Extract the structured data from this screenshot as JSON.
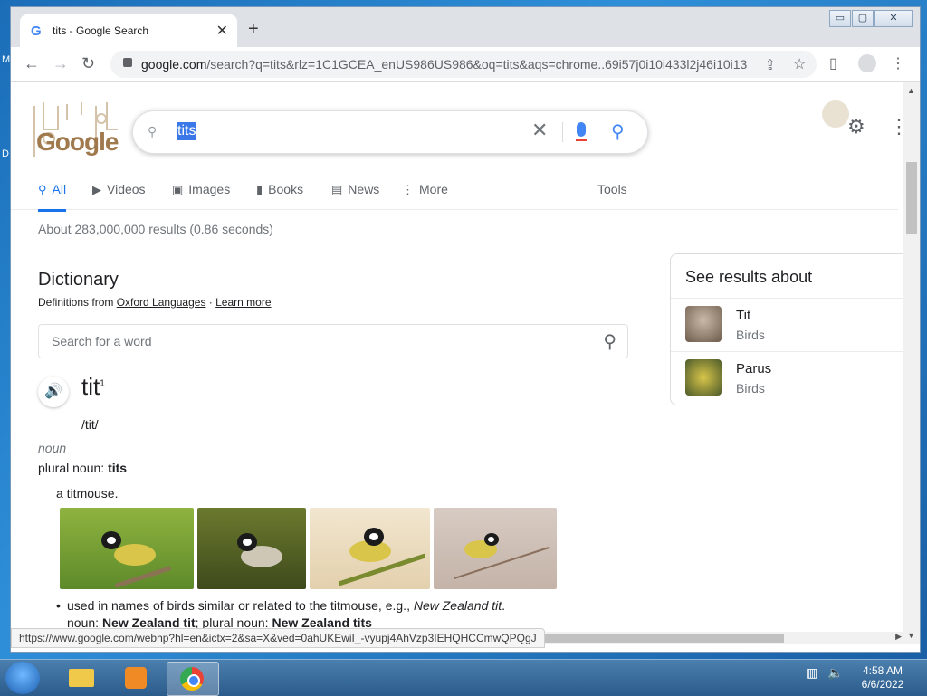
{
  "window": {
    "tab_title": "tits - Google Search",
    "tab_close": "✕",
    "new_tab": "+",
    "url_host": "google.com",
    "url_rest": "/search?q=tits&rlz=1C1GCEA_enUS986US986&oq=tits&aqs=chrome..69i57j0i10i433l2j46i10i13...",
    "controls": {
      "minimize": "▭",
      "maximize": "▢",
      "close": "✕"
    }
  },
  "search": {
    "logo": "Google",
    "query": "tits",
    "clear": "✕"
  },
  "tabs": [
    {
      "label": "All",
      "icon": "search-icon"
    },
    {
      "label": "Videos",
      "icon": "video-icon"
    },
    {
      "label": "Images",
      "icon": "image-icon"
    },
    {
      "label": "Books",
      "icon": "book-icon"
    },
    {
      "label": "News",
      "icon": "news-icon"
    },
    {
      "label": "More",
      "icon": "more-vert-icon"
    }
  ],
  "tools_label": "Tools",
  "result_stats": "About 283,000,000 results (0.86 seconds)",
  "dictionary": {
    "title": "Dictionary",
    "source_prefix": "Definitions from ",
    "source_link": "Oxford Languages",
    "source_sep": " · ",
    "learn_more": "Learn more",
    "search_placeholder": "Search for a word",
    "headword": "tit",
    "homograph": "1",
    "phonetic": "/tit/",
    "pos": "noun",
    "plural_label": "plural noun: ",
    "plural_value": "tits",
    "sense1": "a titmouse.",
    "sense2_text": "used in names of birds similar or related to the titmouse, e.g., ",
    "sense2_example": "New Zealand tit",
    "sense2_noun_label": "noun: ",
    "sense2_noun": "New Zealand tit",
    "sense2_plural_label": "; plural noun: ",
    "sense2_plural": "New Zealand tits"
  },
  "knowledge_panel": {
    "heading": "See results about",
    "items": [
      {
        "name": "Tit",
        "category": "Birds"
      },
      {
        "name": "Parus",
        "category": "Birds"
      }
    ]
  },
  "status_url": "https://www.google.com/webhp?hl=en&ictx=2&sa=X&ved=0ahUKEwiI_-vyupj4AhVzp3IEHQHCCmwQPQgJ",
  "taskbar": {
    "time": "4:58 AM",
    "date": "6/6/2022"
  },
  "colors": {
    "accent": "#1a73e8",
    "highlight": "#3b78e7"
  }
}
